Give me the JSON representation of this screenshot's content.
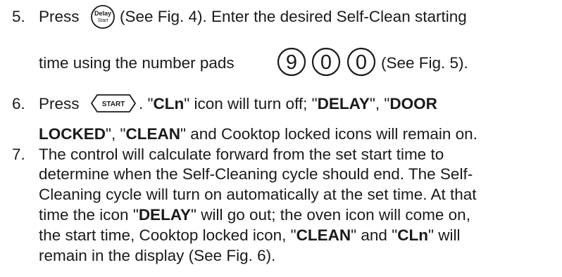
{
  "steps": [
    {
      "number": "5.",
      "line1_a": "Press",
      "delay_icon": {
        "name": "delay-start-button-icon",
        "line1": "Delay",
        "line2": "Start"
      },
      "line1_b": "(See Fig. 4).  Enter the desired Self-Clean starting",
      "line2_a": "time using the number pads",
      "pads": [
        "9",
        "0",
        "0"
      ],
      "line2_b": "(See Fig. 5)."
    },
    {
      "number": "6.",
      "l1_press": "Press",
      "start_icon": {
        "name": "start-button-icon",
        "label": "START"
      },
      "l1_sep": ". ",
      "q1": "\"",
      "cln": "CLn",
      "q2": "\"",
      "l1_off": " icon will turn off; \"",
      "delay": "DELAY",
      "l1_mid": "\", \"",
      "door": "DOOR",
      "locked": "LOCKED",
      "l2_a": "\",  \"",
      "clean": "CLEAN",
      "l2_b": "\" and Cooktop locked icons will remain on."
    },
    {
      "number": "7.",
      "lines": [
        "The control will calculate forward from the set start time to",
        "determine when the Self-Cleaning cycle should end. The Self-",
        "Cleaning cycle will turn on automatically at the set time. At that"
      ],
      "l4_a": "time the icon \"",
      "l4_delay": "DELAY",
      "l4_b": "\" will go out; the oven icon will come on,",
      "l5_a": "the start time, Cooktop locked icon, \"",
      "l5_clean": "CLEAN",
      "l5_b": "\" and \"",
      "l5_cln": "CLn",
      "l5_c": "\" will",
      "l6": "remain  in the display (See Fig. 6)."
    }
  ]
}
